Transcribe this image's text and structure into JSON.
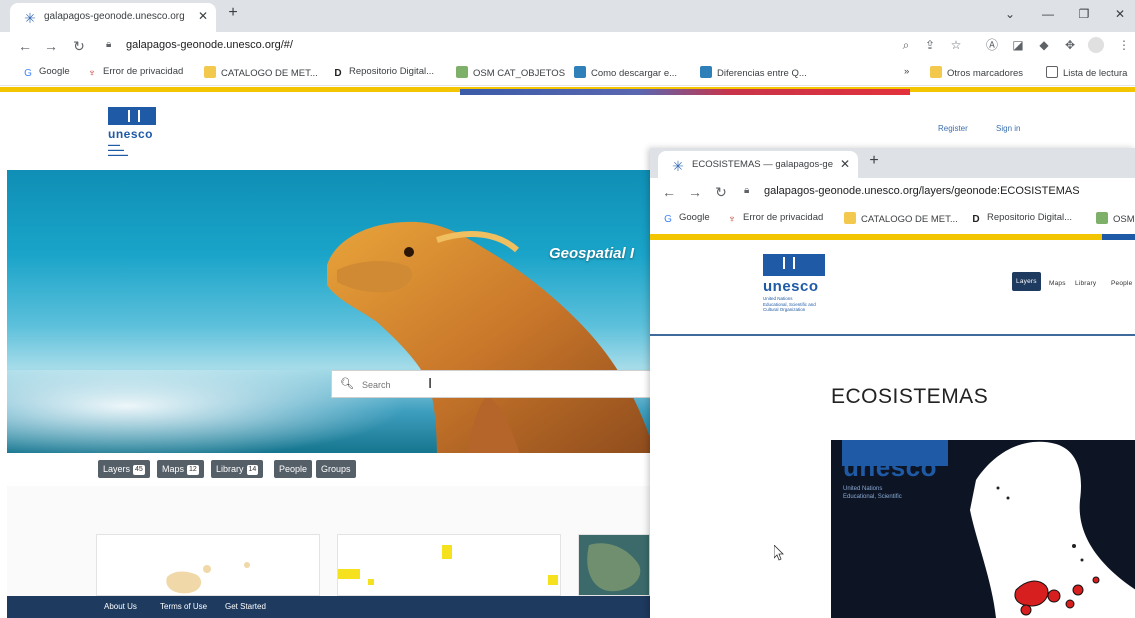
{
  "browser1": {
    "tab_title": "galapagos-geonode.unesco.org",
    "url": "galapagos-geonode.unesco.org/#/",
    "bookmarks": [
      {
        "label": "Google",
        "icon": "google-icon"
      },
      {
        "label": "Error de privacidad",
        "icon": "warning-icon"
      },
      {
        "label": "CATALOGO DE MET...",
        "icon": "catalog-icon"
      },
      {
        "label": "Repositorio Digital...",
        "icon": "repository-icon"
      },
      {
        "label": "OSM CAT_OBJETOS",
        "icon": "osm-icon"
      },
      {
        "label": "Como descargar e...",
        "icon": "doc-icon"
      },
      {
        "label": "Diferencias entre Q...",
        "icon": "doc-icon"
      }
    ],
    "bookmarks_more": "»",
    "other_bookmarks": "Otros marcadores",
    "reading_list": "Lista de lectura"
  },
  "site1": {
    "logo_word": "unesco",
    "header_links": [
      "Register",
      "Sign in"
    ],
    "hero_title": "Geospatial I",
    "search_placeholder": "Search",
    "pills": [
      {
        "label": "Layers",
        "count": "45"
      },
      {
        "label": "Maps",
        "count": "12"
      },
      {
        "label": "Library",
        "count": "14"
      },
      {
        "label": "People",
        "count": ""
      },
      {
        "label": "Groups",
        "count": ""
      }
    ],
    "footer_links": [
      "About Us",
      "Terms of Use",
      "Get Started"
    ]
  },
  "browser2": {
    "tab_title": "ECOSISTEMAS — galapagos-ge",
    "url": "galapagos-geonode.unesco.org/layers/geonode:ECOSISTEMAS",
    "bookmarks": [
      {
        "label": "Google",
        "icon": "google-icon"
      },
      {
        "label": "Error de privacidad",
        "icon": "warning-icon"
      },
      {
        "label": "CATALOGO DE MET...",
        "icon": "catalog-icon"
      },
      {
        "label": "Repositorio Digital...",
        "icon": "repository-icon"
      },
      {
        "label": "OSM",
        "icon": "osm-icon"
      }
    ]
  },
  "site2": {
    "logo_word": "unesco",
    "logo_sub": [
      "United Nations",
      "Educational, Scientific and",
      "Cultural Organization"
    ],
    "nav": [
      "Layers",
      "Maps",
      "Library",
      "People"
    ],
    "heading": "ECOSISTEMAS",
    "map_logo_word": "unesco",
    "map_logo_sub": [
      "United Nations",
      "Educational, Scientific"
    ]
  },
  "colors": {
    "unesco_blue": "#1f5aa6",
    "accent_yellow": "#f2c500",
    "footer_navy": "#1e3a5f",
    "pill_gray": "#555f68"
  }
}
